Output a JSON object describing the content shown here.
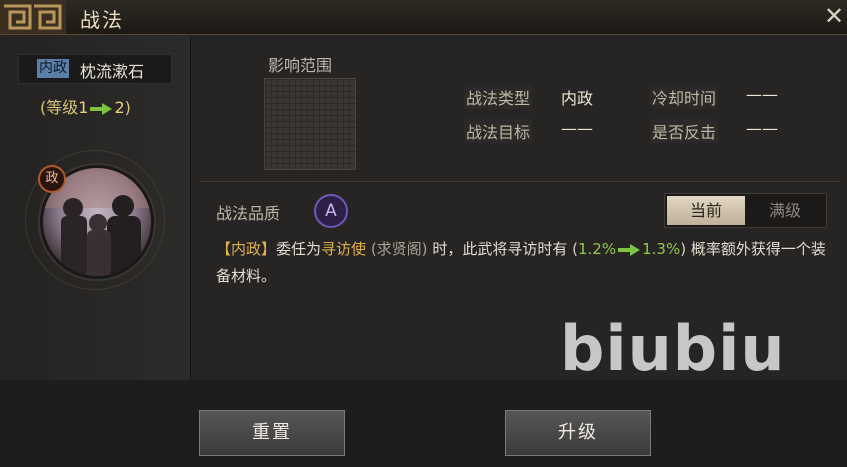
{
  "window": {
    "title": "战法",
    "close_icon": "close-icon"
  },
  "skill": {
    "type_tag": "内政",
    "name": "枕流漱石",
    "level": {
      "open": "(等级",
      "from": "1",
      "to": "2",
      "close": ")"
    },
    "portrait_badge": "政"
  },
  "range": {
    "label": "影响范围"
  },
  "info": {
    "type_label": "战法类型",
    "type_value": "内政",
    "cooldown_label": "冷却时间",
    "cooldown_value": "——",
    "target_label": "战法目标",
    "target_value": "——",
    "counter_label": "是否反击",
    "counter_value": "——"
  },
  "quality": {
    "label": "战法品质",
    "grade": "A"
  },
  "toggle": {
    "current": "当前",
    "max": "满级"
  },
  "description": {
    "tag": "【内政】",
    "part1": "委任为",
    "role": "寻访使",
    "location": "(求贤阁)",
    "part2": "时，此武将寻访时有",
    "open": "(",
    "pct_from": "1.2%",
    "pct_to": "1.3%",
    "close": ")",
    "part3": "概率额外获得一个装备材料。"
  },
  "watermark": "biubiu",
  "buttons": {
    "reset": "重置",
    "upgrade": "升级"
  },
  "colors": {
    "accent_gold": "#e2b24a",
    "accent_green": "#8ec84d",
    "quality_purple": "#6e58b8"
  }
}
